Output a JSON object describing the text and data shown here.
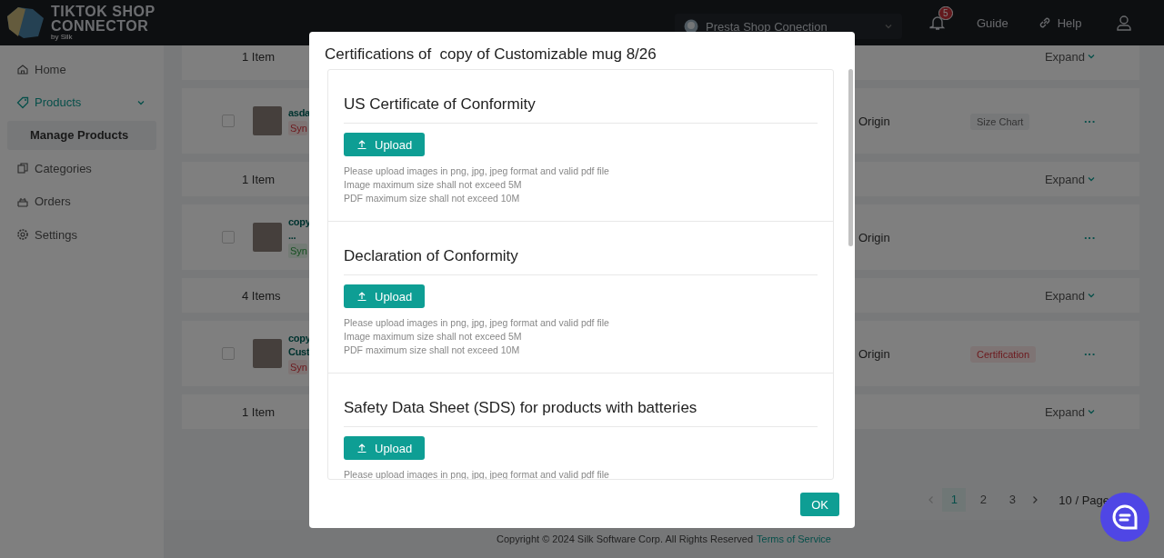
{
  "header": {
    "logo": {
      "line_1": "TIKTOK SHOP",
      "line_2": "CONNECTOR",
      "byline": "by Silk"
    },
    "store_selector": {
      "value": "Presta Shop Conection"
    },
    "notifications": {
      "count": "5"
    },
    "guide": "Guide",
    "help": "Help"
  },
  "sidebar": {
    "items": [
      {
        "label": "Home",
        "selected": false
      },
      {
        "label": "Products",
        "selected": false,
        "expanded": true,
        "children": [
          {
            "label": "Manage Products",
            "selected": true
          }
        ]
      },
      {
        "label": "Categories",
        "selected": false
      },
      {
        "label": "Orders",
        "selected": false
      },
      {
        "label": "Settings",
        "selected": false
      }
    ]
  },
  "product_list": {
    "rows": [
      {
        "kind": "summary",
        "count": "1 Item",
        "expand": "Expand"
      },
      {
        "kind": "product",
        "checked": false,
        "name_lines": [
          "asda"
        ],
        "status": {
          "text": "Syn",
          "kind": "error"
        },
        "origin": "Origin",
        "tag": {
          "text": "Size Chart",
          "kind": "neutral"
        },
        "more": "···"
      },
      {
        "kind": "summary",
        "count": "1 Item",
        "expand": "Expand"
      },
      {
        "kind": "product",
        "checked": false,
        "name_lines": [
          "copy",
          "..."
        ],
        "status": {
          "text": "Syn",
          "kind": "success"
        },
        "origin": "Origin",
        "more": "···"
      },
      {
        "kind": "summary",
        "count": "4 Items",
        "expand": "Expand"
      },
      {
        "kind": "product",
        "checked": false,
        "name_lines": [
          "copy",
          "Cust"
        ],
        "status": {
          "text": "Syn",
          "kind": "error"
        },
        "origin": "Origin",
        "tag": {
          "text": "Certification",
          "kind": "error"
        },
        "more": "···"
      },
      {
        "kind": "summary",
        "count": "1 Item",
        "expand": "Expand"
      }
    ],
    "pagination": {
      "pages": [
        {
          "label": "1",
          "selected": true
        },
        {
          "label": "2",
          "selected": false
        },
        {
          "label": "3",
          "selected": false
        }
      ],
      "page_size": "10 / Page"
    }
  },
  "footer": {
    "copyright": "Copyright © 2024 Silk Software Corp. All Rights Reserved",
    "link": "Terms of Service"
  },
  "modal": {
    "title": "Certifications of  copy of Customizable mug 8/26",
    "sections": [
      {
        "title": "US Certificate of Conformity",
        "button": "Upload",
        "notes": [
          "Please upload images in png, jpg, jpeg format and valid pdf file",
          "Image maximum size shall not exceed 5M",
          "PDF maximum size shall not exceed 10M"
        ]
      },
      {
        "title": "Declaration of Conformity",
        "button": "Upload",
        "notes": [
          "Please upload images in png, jpg, jpeg format and valid pdf file",
          "Image maximum size shall not exceed 5M",
          "PDF maximum size shall not exceed 10M"
        ]
      },
      {
        "title": "Safety Data Sheet (SDS) for products with batteries",
        "button": "Upload",
        "notes": [
          "Please upload images in png, jpg, jpeg format and valid pdf file"
        ]
      }
    ],
    "ok": "OK"
  }
}
